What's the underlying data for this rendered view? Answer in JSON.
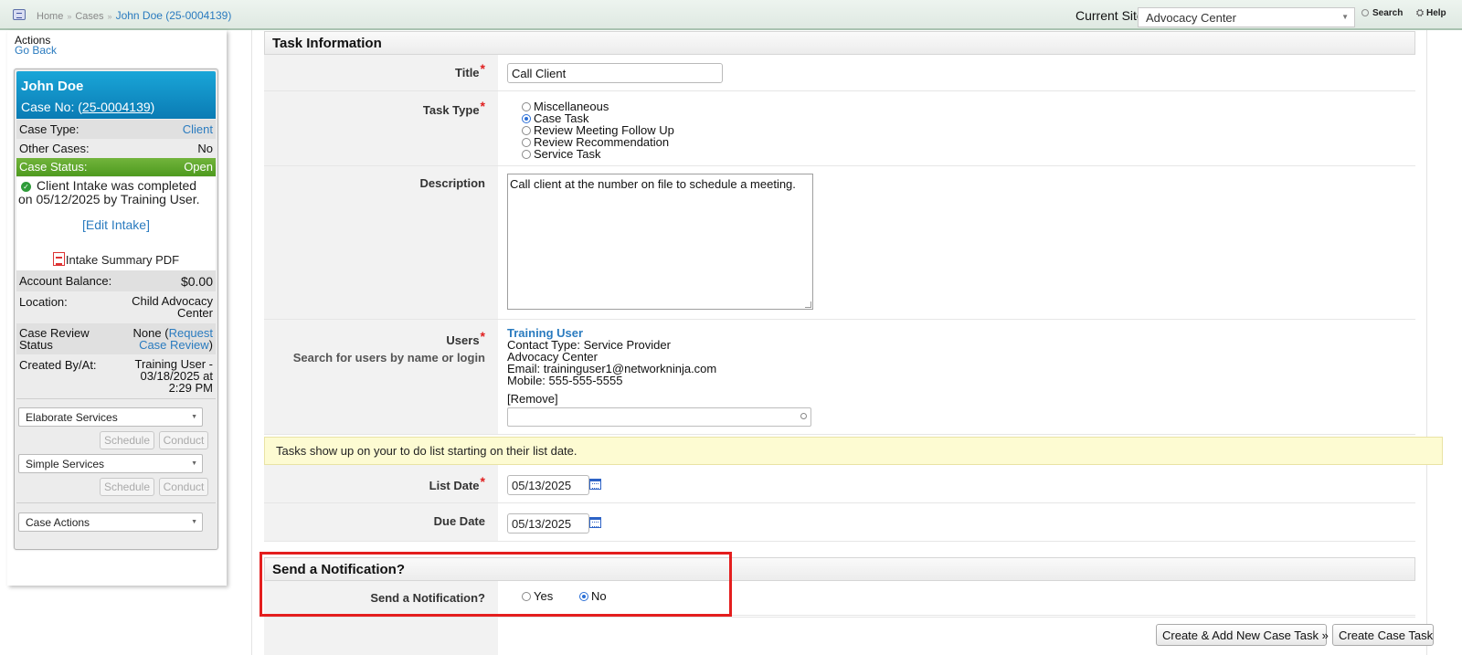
{
  "topbar": {
    "breadcrumb": [
      "Home",
      "Cases",
      "John Doe (25-0004139)"
    ],
    "breadcrumb_separator": "»",
    "current_site_label": "Current Site",
    "current_site_value": "Advocacy Center",
    "search_label": "Search",
    "help_label": "Help"
  },
  "sidebar": {
    "actions_title": "Actions",
    "go_back": "Go Back",
    "case": {
      "name": "John Doe",
      "case_no_label": "Case No: (",
      "case_no": "25-0004139",
      "case_no_close": ")",
      "rows": [
        {
          "label": "Case Type:",
          "value": "Client"
        },
        {
          "label": "Other Cases:",
          "value": "No"
        },
        {
          "label": "Case Status:",
          "value": "Open"
        }
      ],
      "intake_text": "Client Intake was completed on 05/12/2025 by Training User.",
      "edit_intake": "[Edit Intake]",
      "pdf_label": "Intake Summary PDF",
      "account_balance_label": "Account Balance:",
      "account_balance_value": "$0.00",
      "location_label": "Location:",
      "location_value_1": "Child Advocacy",
      "location_value_2": "Center",
      "review_label_1": "Case Review",
      "review_label_2": "Status",
      "review_none": "None (",
      "review_link_1": "Request",
      "review_link_2": "Case Review",
      "review_close": ")",
      "created_label": "Created By/At:",
      "created_value_1": "Training User -",
      "created_value_2": "03/18/2025 at",
      "created_value_3": "2:29 PM"
    },
    "elaborate_services": "Elaborate Services",
    "simple_services": "Simple Services",
    "case_actions": "Case Actions",
    "schedule_label": "Schedule",
    "conduct_label": "Conduct"
  },
  "form": {
    "task_info_title": "Task Information",
    "title_label": "Title",
    "title_value": "Call Client",
    "task_type_label": "Task Type",
    "task_types": [
      "Miscellaneous",
      "Case Task",
      "Review Meeting Follow Up",
      "Review Recommendation",
      "Service Task"
    ],
    "task_type_selected": "Case Task",
    "description_label": "Description",
    "description_value": "Call client at the number on file to schedule a meeting.",
    "users_label": "Users",
    "users_help": "Search for users by name or login",
    "user": {
      "name": "Training User",
      "contact_type": "Contact Type: Service Provider",
      "org": "Advocacy Center",
      "email": "Email: traininguser1@networkninja.com",
      "mobile": "Mobile: 555-555-5555",
      "remove": "[Remove]"
    },
    "notice": "Tasks show up on your to do list starting on their list date.",
    "list_date_label": "List Date",
    "list_date_value": "05/13/2025",
    "due_date_label": "Due Date",
    "due_date_value": "05/13/2025",
    "notify_title": "Send a Notification?",
    "notify_label": "Send a Notification?",
    "notify_yes": "Yes",
    "notify_no": "No",
    "notify_selected": "No",
    "btn_create_add": "Create & Add New Case Task »",
    "btn_create": "Create Case Task"
  },
  "colors": {
    "case_header": "#0a7bb4",
    "case_status": "#5aa62a",
    "link": "#2a7bbf",
    "required": "#e02020",
    "highlight": "#e41e1e",
    "notice_bg": "#fdfbd2"
  }
}
